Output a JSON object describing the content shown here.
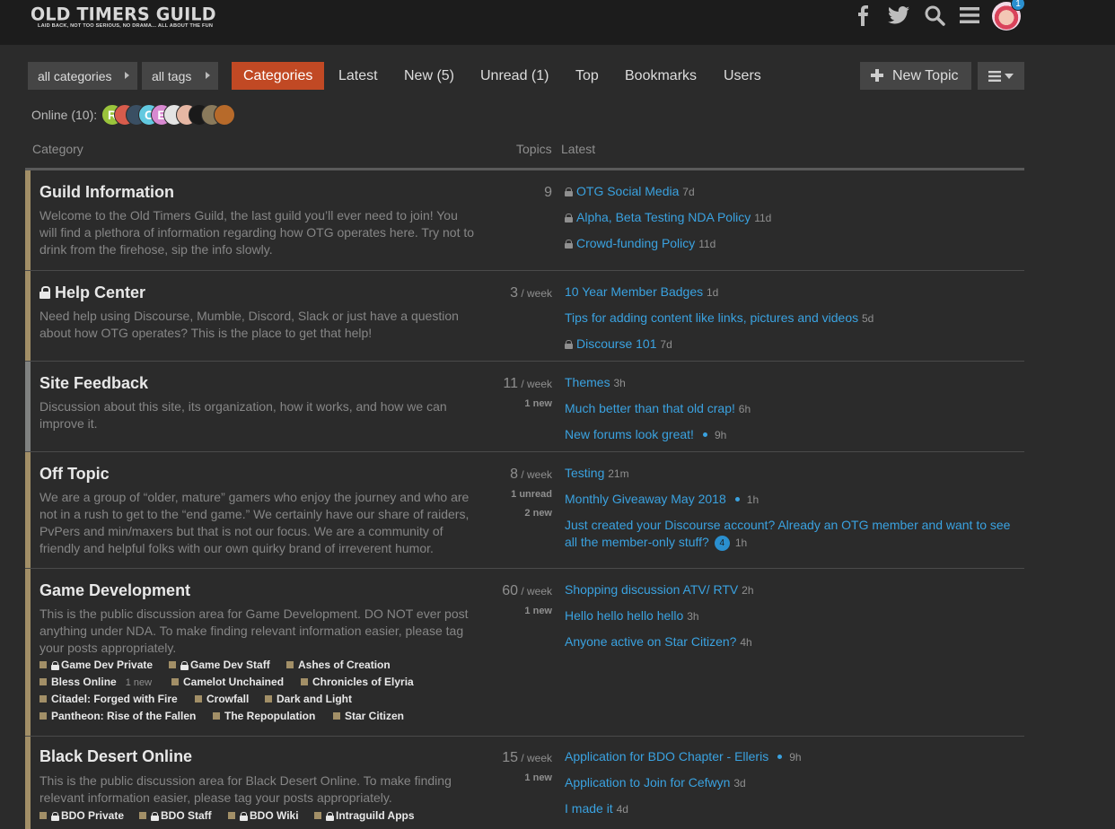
{
  "header": {
    "logo_title": "OLD TIMERS GUILD",
    "logo_tagline": "LAID BACK, NOT TOO SERIOUS, NO DRAMA... ALL ABOUT THE FUN",
    "icons": [
      "facebook-icon",
      "twitter-icon",
      "search-icon",
      "hamburger-icon",
      "user-avatar"
    ],
    "notification_count": "1"
  },
  "nav": {
    "all_categories": "all categories",
    "all_tags": "all tags",
    "tabs": [
      "Categories",
      "Latest",
      "New (5)",
      "Unread (1)",
      "Top",
      "Bookmarks",
      "Users"
    ],
    "active_tab": "Categories",
    "new_topic": "New Topic"
  },
  "online": {
    "label": "Online (10):",
    "avatars": [
      "R",
      "",
      "",
      "C",
      "E",
      "",
      "",
      "",
      "",
      ""
    ]
  },
  "table_header": {
    "category": "Category",
    "topics": "Topics",
    "latest": "Latest"
  },
  "categories": [
    {
      "name": "Guild Information",
      "locked": false,
      "color": "#a28f67",
      "description": "Welcome to the Old Timers Guild, the last guild you’ll ever need to join! You will find a plethora of information regarding how OTG operates here. Try not to drink from the firehose, sip the info slowly.",
      "topics": "9",
      "per": "",
      "extra": [],
      "latest": [
        {
          "title": "OTG Social Media",
          "age": "7d",
          "locked": true
        },
        {
          "title": "Alpha, Beta Testing NDA Policy",
          "age": "11d",
          "locked": true
        },
        {
          "title": "Crowd-funding Policy",
          "age": "11d",
          "locked": true
        }
      ]
    },
    {
      "name": "Help Center",
      "locked": true,
      "color": "#a28f67",
      "description": "Need help using Discourse, Mumble, Discord, Slack or just have a question about how OTG operates? This is the place to get that help!",
      "topics": "3",
      "per": " / week",
      "extra": [],
      "latest": [
        {
          "title": "10 Year Member Badges",
          "age": "1d",
          "locked": false
        },
        {
          "title": "Tips for adding content like links, pictures and videos",
          "age": "5d",
          "locked": false
        },
        {
          "title": "Discourse 101",
          "age": "7d",
          "locked": true
        }
      ]
    },
    {
      "name": "Site Feedback",
      "locked": false,
      "color": "#808281",
      "description": "Discussion about this site, its organization, how it works, and how we can improve it.",
      "topics": "11",
      "per": " / week",
      "extra": [
        "1 new"
      ],
      "latest": [
        {
          "title": "Themes",
          "age": "3h",
          "locked": false
        },
        {
          "title": "Much better than that old crap!",
          "age": "6h",
          "locked": false
        },
        {
          "title": "New forums look great!",
          "age": "9h",
          "locked": false,
          "dot": true
        }
      ]
    },
    {
      "name": "Off Topic",
      "locked": false,
      "color": "#a28f67",
      "description": "We are a group of “older, mature” gamers who enjoy the journey and who are not in a rush to get to the “end game.” We certainly have our share of raiders, PvPers and min/maxers but that is not our focus. We are a community of friendly and helpful folks with our own quirky brand of irreverent humor.",
      "topics": "8",
      "per": " / week",
      "extra": [
        "1 unread",
        "2 new"
      ],
      "latest": [
        {
          "title": "Testing",
          "age": "21m",
          "locked": false
        },
        {
          "title": "Monthly Giveaway May 2018",
          "age": "1h",
          "locked": false,
          "dot": true
        },
        {
          "title": "Just created your Discourse account? Already an OTG member and want to see",
          "title2": "all the member-only stuff?",
          "age": "1h",
          "locked": false,
          "bubble": "4"
        }
      ]
    },
    {
      "name": "Game Development",
      "locked": false,
      "color": "#a28f67",
      "description": "This is the public discussion area for Game Development. DO NOT ever post anything under NDA. To make finding relevant information easier, please tag your posts appropriately.",
      "topics": "60",
      "per": " / week",
      "extra": [
        "1 new"
      ],
      "subcategories": [
        {
          "name": "Game Dev Private",
          "locked": true
        },
        {
          "name": "Game Dev Staff",
          "locked": true
        },
        {
          "name": "Ashes of Creation",
          "locked": false
        },
        {
          "name": "Bless Online",
          "locked": false,
          "new": "1 new"
        },
        {
          "name": "Camelot Unchained",
          "locked": false
        },
        {
          "name": "Chronicles of Elyria",
          "locked": false
        },
        {
          "name": "Citadel: Forged with Fire",
          "locked": false
        },
        {
          "name": "Crowfall",
          "locked": false
        },
        {
          "name": "Dark and Light",
          "locked": false
        },
        {
          "name": "Pantheon: Rise of the Fallen",
          "locked": false
        },
        {
          "name": "The Repopulation",
          "locked": false
        },
        {
          "name": "Star Citizen",
          "locked": false
        }
      ],
      "latest": [
        {
          "title": "Shopping discussion ATV/ RTV",
          "age": "2h",
          "locked": false
        },
        {
          "title": "Hello hello hello hello",
          "age": "3h",
          "locked": false
        },
        {
          "title": "Anyone active on Star Citizen?",
          "age": "4h",
          "locked": false
        }
      ]
    },
    {
      "name": "Black Desert Online",
      "locked": false,
      "color": "#a28f67",
      "description": "This is the public discussion area for Black Desert Online. To make finding relevant information easier, please tag your posts appropriately.",
      "topics": "15",
      "per": " / week",
      "extra": [
        "1 new"
      ],
      "subcategories": [
        {
          "name": "BDO Private",
          "locked": true
        },
        {
          "name": "BDO Staff",
          "locked": true
        },
        {
          "name": "BDO Wiki",
          "locked": true
        },
        {
          "name": "Intraguild Apps",
          "locked": true
        }
      ],
      "latest": [
        {
          "title": "Application for BDO Chapter - Elleris",
          "age": "9h",
          "locked": false,
          "dot": true
        },
        {
          "title": "Application to Join for Cefwyn",
          "age": "3d",
          "locked": false
        },
        {
          "title": "I made it",
          "age": "4d",
          "locked": false
        }
      ]
    }
  ]
}
